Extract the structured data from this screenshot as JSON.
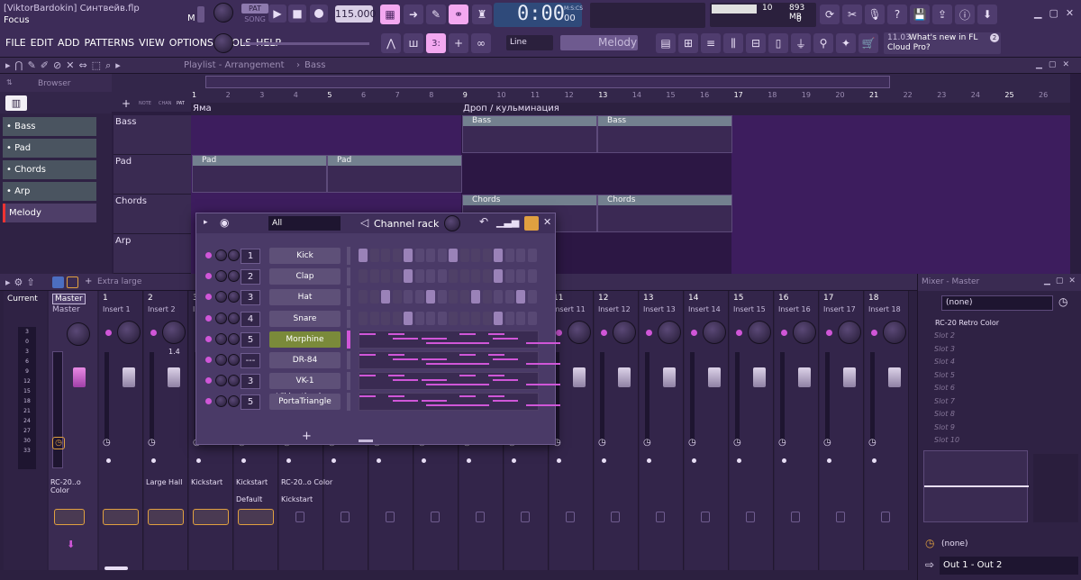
{
  "header": {
    "user_file": "[ViktorBardokin] Синтвейв.flp",
    "hint": "Focus",
    "mode_pat": "PAT",
    "mode_song": "SONG",
    "tempo": "115.000",
    "time": "0:00",
    "time_sub": "00",
    "time_unit": "M:S:CS",
    "cpu": "10",
    "ram": "893 MB",
    "voices": "0",
    "news_time": "11.03",
    "news_text": "What's new in FL Cloud Pro?",
    "news_badge": "2",
    "snap": "Line",
    "pattern": "Melody",
    "menu_indicator": "M"
  },
  "menu": [
    "FILE",
    "EDIT",
    "ADD",
    "PATTERNS",
    "VIEW",
    "OPTIONS",
    "TOOLS",
    "HELP"
  ],
  "browser": {
    "title": "Browser",
    "tabs": [
      "NOTE",
      "CHAN",
      "PAT"
    ],
    "items": [
      "Bass",
      "Pad",
      "Chords",
      "Arp",
      "Melody"
    ]
  },
  "playlist": {
    "title": "Playlist - Arrangement",
    "current": "Bass",
    "ruler": [
      "1",
      "2",
      "3",
      "4",
      "5",
      "6",
      "7",
      "8",
      "9",
      "10",
      "11",
      "12",
      "13",
      "14",
      "15",
      "16",
      "17",
      "18",
      "19",
      "20",
      "21",
      "22",
      "23",
      "24",
      "25",
      "26"
    ],
    "markers": [
      "Яма",
      "Дроп / кульминация"
    ],
    "tracks": [
      "Bass",
      "Pad",
      "Chords",
      "Arp"
    ],
    "clips": {
      "bass": "Bass",
      "pad": "Pad",
      "chords": "Chords"
    }
  },
  "channel_rack": {
    "title": "Channel rack",
    "filter": "All",
    "channels": [
      {
        "name": "Kick",
        "num": "1"
      },
      {
        "name": "Clap",
        "num": "2"
      },
      {
        "name": "Hat",
        "num": "3"
      },
      {
        "name": "Snare",
        "num": "4"
      },
      {
        "name": "Morphine",
        "num": "5"
      },
      {
        "name": "DR-84",
        "num": "---"
      },
      {
        "name": "VK-1 Viki..nthesizer",
        "num": "3"
      },
      {
        "name": "PortaTriangle",
        "num": "5"
      }
    ]
  },
  "mixer": {
    "size": "Extra large",
    "current": "Current",
    "master": "Master",
    "inserts": [
      "Insert 1",
      "Insert 2",
      "Insert 3",
      "Insert 4",
      "Insert 5",
      "Insert 6",
      "Insert 7",
      "Insert 8",
      "Insert 9",
      "Insert 10",
      "Insert 11",
      "Insert 12",
      "Insert 13",
      "Insert 14",
      "Insert 15",
      "Insert 16",
      "Insert 17",
      "Insert 18"
    ],
    "nums": [
      "1",
      "2",
      "3",
      "4",
      "5",
      "6",
      "7",
      "8",
      "9",
      "10",
      "11",
      "12",
      "13",
      "14",
      "15",
      "16",
      "17",
      "18"
    ],
    "pan_value": "1.4",
    "meter_scale": [
      "3",
      "0",
      "3",
      "6",
      "9",
      "12",
      "15",
      "18",
      "21",
      "24",
      "27",
      "30",
      "33"
    ],
    "fx_master": "RC-20..o Color",
    "fx_i2": "Large Hall",
    "fx_i3": "Kickstart",
    "fx_i4": "Kickstart",
    "fx_i4b": "Default",
    "fx_i5": "RC-20..o Color",
    "fx_i5b": "Kickstart"
  },
  "mixer_master": {
    "title": "Mixer - Master",
    "preset": "(none)",
    "slot1": "RC-20 Retro Color",
    "slots": [
      "Slot 2",
      "Slot 3",
      "Slot 4",
      "Slot 5",
      "Slot 6",
      "Slot 7",
      "Slot 8",
      "Slot 9",
      "Slot 10"
    ],
    "eq_preset": "(none)",
    "output": "Out 1 - Out 2"
  }
}
